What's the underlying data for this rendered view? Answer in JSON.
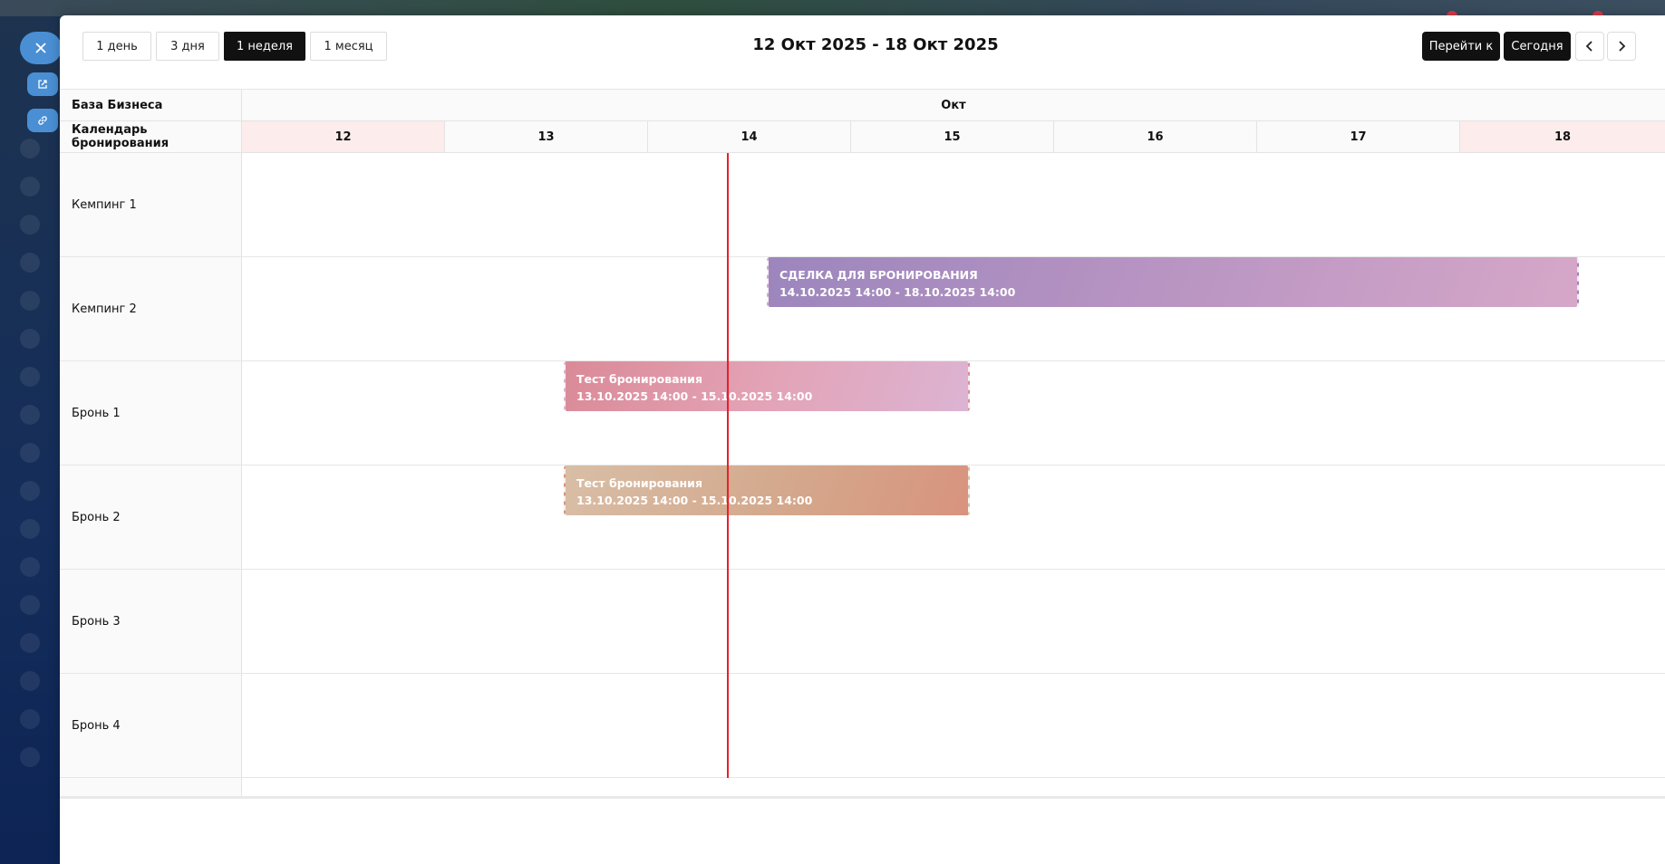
{
  "toolbar": {
    "views": [
      "1 день",
      "3 дня",
      "1 неделя",
      "1 месяц"
    ],
    "active_view": "1 неделя",
    "range_title": "12 Окт 2025 - 18 Окт 2025",
    "goto_label": "Перейти к",
    "today_label": "Сегодня",
    "prev_icon": "chevron-left-icon",
    "next_icon": "chevron-right-icon"
  },
  "header": {
    "business_label": "База Бизнеса",
    "calendar_label": "Календарь бронирования",
    "month": "Окт",
    "days": [
      "12",
      "13",
      "14",
      "15",
      "16",
      "17",
      "18"
    ],
    "weekend_days": [
      "12",
      "18"
    ]
  },
  "resources": [
    "Кемпинг 1",
    "Кемпинг 2",
    "Бронь 1",
    "Бронь 2",
    "Бронь 3",
    "Бронь 4"
  ],
  "events": [
    {
      "resource": "Кемпинг 2",
      "title": "СДЕЛКА ДЛЯ БРОНИРОВАНИЯ",
      "dates": "14.10.2025 14:00 - 18.10.2025 14:00",
      "color": "#a98dc0"
    },
    {
      "resource": "Бронь 1",
      "title": "Тест бронирования",
      "dates": "13.10.2025 14:00 - 15.10.2025 14:00",
      "color": "#df95a7"
    },
    {
      "resource": "Бронь 2",
      "title": "Тест бронирования",
      "dates": "13.10.2025 14:00 - 15.10.2025 14:00",
      "color": "#d6a78c"
    }
  ],
  "colors": {
    "now_line": "#e8202a",
    "weekend_bg": "#fdecec",
    "accent_dark": "#111111"
  }
}
